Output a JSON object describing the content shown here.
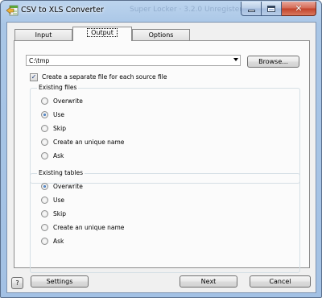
{
  "window": {
    "title": "CSV to XLS Converter",
    "ghost_title": "Super Locker · 3.2.0 Unregistered Pro"
  },
  "tabs": [
    {
      "label": "Input",
      "selected": false
    },
    {
      "label": "Output",
      "selected": true
    },
    {
      "label": "Options",
      "selected": false
    }
  ],
  "output": {
    "folder_value": "C:\\tmp",
    "browse_label": "Browse...",
    "separate_file": {
      "label": "Create a separate file for each source file",
      "checked": true
    }
  },
  "existing_files": {
    "title": "Existing files",
    "options": [
      {
        "label": "Overwrite",
        "selected": false
      },
      {
        "label": "Use",
        "selected": true
      },
      {
        "label": "Skip",
        "selected": false
      },
      {
        "label": "Create an unique name",
        "selected": false
      },
      {
        "label": "Ask",
        "selected": false
      }
    ]
  },
  "existing_tables": {
    "title": "Existing tables",
    "options": [
      {
        "label": "Overwrite",
        "selected": true
      },
      {
        "label": "Use",
        "selected": false
      },
      {
        "label": "Skip",
        "selected": false
      },
      {
        "label": "Create an unique name",
        "selected": false
      },
      {
        "label": "Ask",
        "selected": false
      }
    ]
  },
  "footer": {
    "help_label": "?",
    "settings_label": "Settings",
    "next_label": "Next",
    "cancel_label": "Cancel"
  },
  "icons": {
    "app": "spreadsheet-converter-icon",
    "minimize": "minimize-icon",
    "maximize": "maximize-icon",
    "close": "close-icon",
    "dropdown": "chevron-down-icon",
    "check": "checkmark-icon"
  },
  "colors": {
    "frame": "#a9c6e6",
    "close_button": "#c2432a",
    "panel": "#fbfbfb",
    "radio_dot": "#1c4f99"
  }
}
